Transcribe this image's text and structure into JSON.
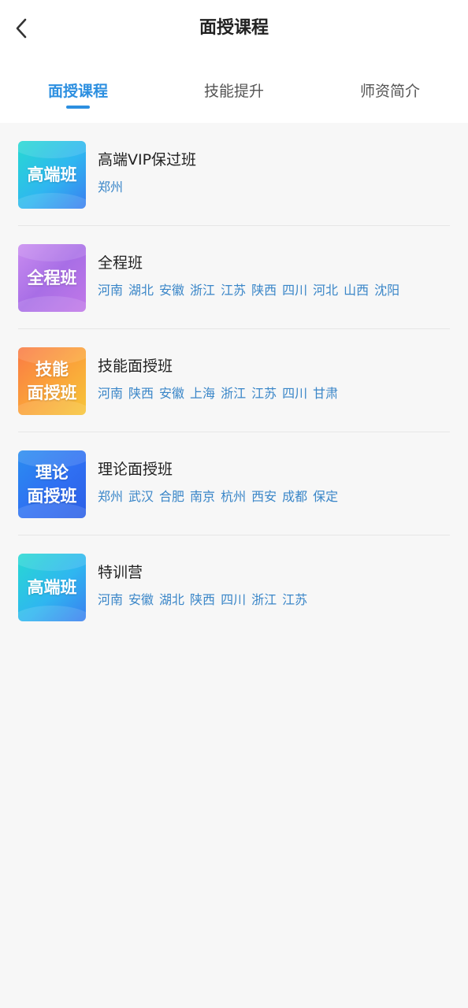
{
  "header": {
    "title": "面授课程",
    "back_icon": "chevron-left-icon"
  },
  "tabs": [
    {
      "label": "面授课程",
      "active": true
    },
    {
      "label": "技能提升",
      "active": false
    },
    {
      "label": "师资简介",
      "active": false
    }
  ],
  "colors": {
    "accent": "#2c8fe0",
    "city_text": "#3a86c8",
    "background": "#f7f7f7"
  },
  "courses": [
    {
      "thumb_text": "高端班",
      "thumb_style": "cyan",
      "name": "高端VIP保过班",
      "cities": [
        "郑州"
      ]
    },
    {
      "thumb_text": "全程班",
      "thumb_style": "purple",
      "name": "全程班",
      "cities": [
        "河南",
        "湖北",
        "安徽",
        "浙江",
        "江苏",
        "陕西",
        "四川",
        "河北",
        "山西",
        "沈阳"
      ]
    },
    {
      "thumb_text": "技能\n面授班",
      "thumb_style": "orange",
      "name": "技能面授班",
      "cities": [
        "河南",
        "陕西",
        "安徽",
        "上海",
        "浙江",
        "江苏",
        "四川",
        "甘肃"
      ]
    },
    {
      "thumb_text": "理论\n面授班",
      "thumb_style": "blue",
      "name": "理论面授班",
      "cities": [
        "郑州",
        "武汉",
        "合肥",
        "南京",
        "杭州",
        "西安",
        "成都",
        "保定"
      ]
    },
    {
      "thumb_text": "高端班",
      "thumb_style": "cyan",
      "name": "特训营",
      "cities": [
        "河南",
        "安徽",
        "湖北",
        "陕西",
        "四川",
        "浙江",
        "江苏"
      ]
    }
  ]
}
